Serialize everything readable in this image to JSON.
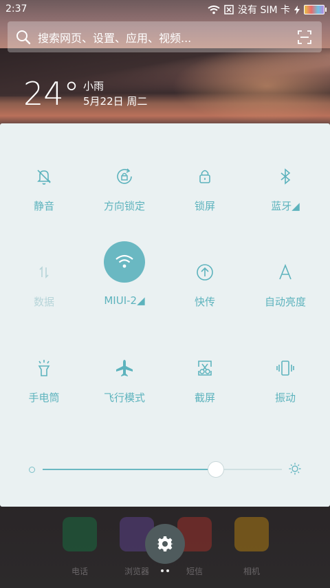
{
  "statusbar": {
    "time": "2:37",
    "sim_text": "没有 SIM 卡",
    "icons": [
      "wifi-icon",
      "no-sim-icon",
      "charging-icon",
      "battery-icon"
    ]
  },
  "search": {
    "placeholder": "搜索网页、设置、应用、视频..."
  },
  "weather": {
    "temperature": "24°",
    "condition": "小雨",
    "date": "5月22日 周二"
  },
  "toggles": [
    {
      "label": "静音",
      "icon": "bell-off-icon",
      "active": false
    },
    {
      "label": "方向锁定",
      "icon": "rotation-lock-icon",
      "active": false
    },
    {
      "label": "锁屏",
      "icon": "lock-icon",
      "active": false
    },
    {
      "label": "蓝牙◢",
      "icon": "bluetooth-icon",
      "active": false
    },
    {
      "label": "数据",
      "icon": "mobile-data-icon",
      "active": false,
      "disabled": true
    },
    {
      "label": "MIUI-2◢",
      "icon": "wifi-icon",
      "active": true
    },
    {
      "label": "快传",
      "icon": "quick-transfer-icon",
      "active": false
    },
    {
      "label": "自动亮度",
      "icon": "auto-brightness-icon",
      "active": false
    },
    {
      "label": "手电筒",
      "icon": "flashlight-icon",
      "active": false
    },
    {
      "label": "飞行模式",
      "icon": "airplane-icon",
      "active": false
    },
    {
      "label": "截屏",
      "icon": "screenshot-icon",
      "active": false
    },
    {
      "label": "振动",
      "icon": "vibrate-icon",
      "active": false
    }
  ],
  "brightness": {
    "level": 0.72
  },
  "dock": [
    {
      "label": "电话",
      "icon": "phone-icon",
      "color": "#2f8a55"
    },
    {
      "label": "浏览器",
      "icon": "browser-icon",
      "color": "#7a5aa8"
    },
    {
      "label": "短信",
      "icon": "messages-icon",
      "color": "#c9463d"
    },
    {
      "label": "相机",
      "icon": "camera-icon",
      "color": "#e2a21e"
    }
  ],
  "colors": {
    "accent": "#6ab8c2",
    "panel": "#eaf1f2",
    "label": "#5db3bd",
    "dim_label": "#b7d5d9"
  }
}
